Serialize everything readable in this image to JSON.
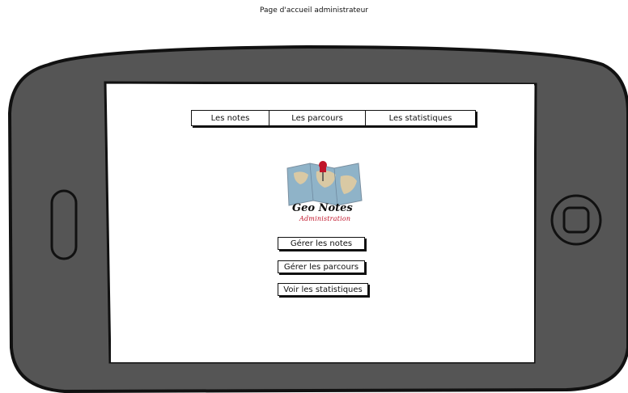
{
  "page": {
    "title": "Page d'accueil administrateur"
  },
  "nav": {
    "tabs": [
      {
        "label": "Les notes"
      },
      {
        "label": "Les parcours"
      },
      {
        "label": "Les statistiques"
      }
    ]
  },
  "logo": {
    "title": "Geo Notes",
    "subtitle": "Administration",
    "icons": [
      "map-icon",
      "pushpin-icon"
    ]
  },
  "actions": {
    "manage_notes": "Gérer les notes",
    "manage_routes": "Gérer les parcours",
    "view_stats": "Voir les statistiques"
  },
  "colors": {
    "phone_body": "#555555",
    "outline": "#111111",
    "pin": "#c0152a",
    "map_water": "#8fb3c8",
    "map_land": "#d9c9a4"
  }
}
